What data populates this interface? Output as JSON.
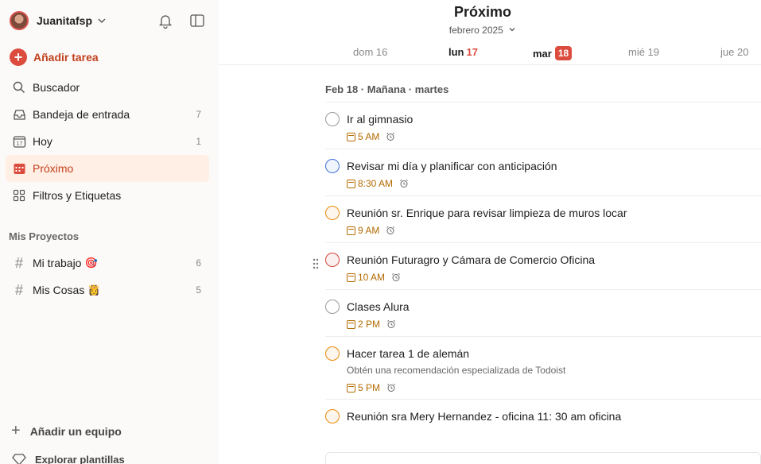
{
  "user": {
    "name": "Juanitafsp"
  },
  "add_task": {
    "label": "Añadir tarea"
  },
  "nav": [
    {
      "label": "Buscador",
      "count": ""
    },
    {
      "label": "Bandeja de entrada",
      "count": "7"
    },
    {
      "label": "Hoy",
      "count": "1"
    },
    {
      "label": "Próximo",
      "count": ""
    },
    {
      "label": "Filtros y Etiquetas",
      "count": ""
    }
  ],
  "today_icon_number": "17",
  "projects_title": "Mis Proyectos",
  "projects": [
    {
      "label": "Mi trabajo",
      "emoji": "🎯",
      "count": "6"
    },
    {
      "label": "Mis Cosas",
      "emoji": "👸",
      "count": "5"
    }
  ],
  "add_team": "Añadir un equipo",
  "templates": "Explorar plantillas",
  "main": {
    "title": "Próximo",
    "month": "febrero 2025",
    "days": [
      {
        "label": "dom 16"
      },
      {
        "name": "lun",
        "num": "17"
      },
      {
        "name": "mar",
        "num": "18"
      },
      {
        "label": "mié 19"
      },
      {
        "label": "jue 20"
      }
    ],
    "date_heading": "Feb 18 · Mañana · martes",
    "tasks": [
      {
        "title": "Ir al gimnasio",
        "time": "5 AM",
        "priority": "none",
        "description": ""
      },
      {
        "title": "Revisar mi día y planificar con anticipación",
        "time": "8:30 AM",
        "priority": "blue",
        "description": ""
      },
      {
        "title": "Reunión sr. Enrique para revisar limpieza de muros locar",
        "time": "9 AM",
        "priority": "orange",
        "description": ""
      },
      {
        "title": "Reunión Futuragro y Cámara de Comercio Oficina",
        "time": "10 AM",
        "priority": "red",
        "description": ""
      },
      {
        "title": "Clases Alura",
        "time": "2 PM",
        "priority": "none",
        "description": ""
      },
      {
        "title": "Hacer tarea 1 de alemán",
        "time": "5 PM",
        "priority": "orange",
        "description": "Obtén una recomendación especializada de Todoist"
      },
      {
        "title": "Reunión sra Mery Hernandez - oficina 11: 30 am oficina",
        "time": "",
        "priority": "orange",
        "description": ""
      }
    ]
  },
  "colors": {
    "accent": "#dc4c3e",
    "accent_text": "#c2401d",
    "active_bg": "#ffefe5",
    "due": "#b36a00"
  }
}
